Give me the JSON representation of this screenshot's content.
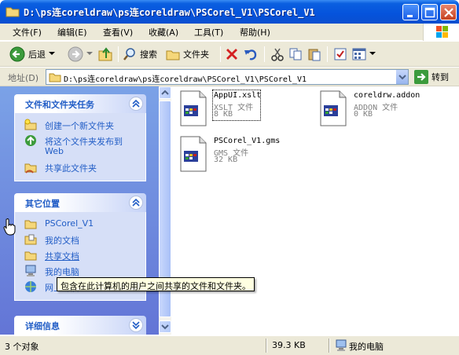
{
  "window": {
    "title": "D:\\ps连coreldraw\\ps连coreldraw\\PSCorel_V1\\PSCorel_V1"
  },
  "menu": [
    {
      "label": "文件(F)"
    },
    {
      "label": "编辑(E)"
    },
    {
      "label": "查看(V)"
    },
    {
      "label": "收藏(A)"
    },
    {
      "label": "工具(T)"
    },
    {
      "label": "帮助(H)"
    }
  ],
  "toolbar": {
    "back_label": "后退",
    "search_label": "搜索",
    "folders_label": "文件夹"
  },
  "address": {
    "label": "地址(D)",
    "value": "D:\\ps连coreldraw\\ps连coreldraw\\PSCorel_V1\\PSCorel_V1",
    "go_label": "转到"
  },
  "left_panels": {
    "file_tasks": {
      "title": "文件和文件夹任务",
      "items": [
        {
          "label": "创建一个新文件夹"
        },
        {
          "label": "将这个文件夹发布到"
        },
        {
          "label": "Web"
        },
        {
          "label": "共享此文件夹"
        }
      ]
    },
    "other_places": {
      "title": "其它位置",
      "items": [
        {
          "label": "PSCorel_V1"
        },
        {
          "label": "我的文档"
        },
        {
          "label": "共享文档"
        },
        {
          "label": "我的电脑"
        },
        {
          "label": "网上邻居"
        }
      ]
    },
    "details": {
      "title": "详细信息"
    }
  },
  "files": [
    {
      "name": "AppUI.xslt",
      "type": "XSLT 文件",
      "size": "8 KB"
    },
    {
      "name": "coreldrw.addon",
      "type": "ADDON 文件",
      "size": "0 KB"
    },
    {
      "name": "PSCorel_V1.gms",
      "type": "GMS 文件",
      "size": "32 KB"
    }
  ],
  "tooltip": "包含在此计算机的用户之间共享的文件和文件夹。",
  "status": {
    "count": "3 个对象",
    "size": "39.3 KB",
    "location": "我的电脑"
  },
  "colors": {
    "title_blue": "#0553dc",
    "task_link": "#215dc6",
    "pane_blue": "#7ba2e7"
  }
}
